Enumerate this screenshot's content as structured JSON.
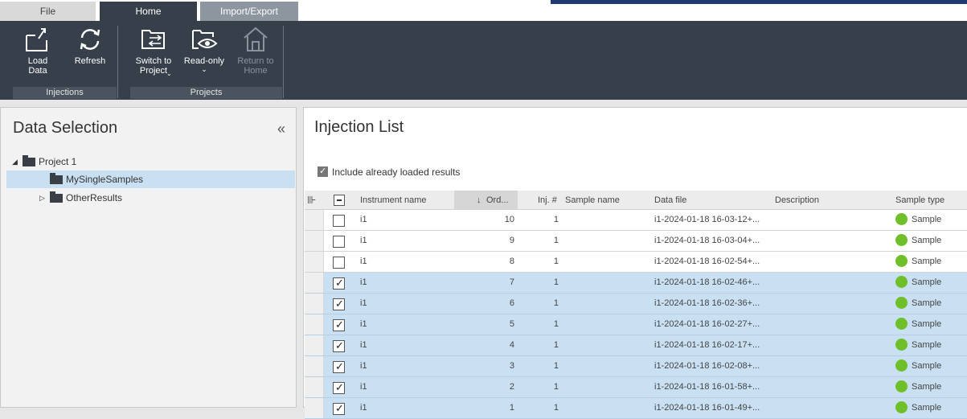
{
  "tabs": {
    "file": "File",
    "home": "Home",
    "import_export": "Import/Export"
  },
  "ribbon": {
    "load_data": "Load\nData",
    "refresh": "Refresh",
    "switch_to_project": "Switch to\nProject",
    "read_only": "Read-only",
    "return_to_home": "Return to\nHome",
    "group_injections": "Injections",
    "group_projects": "Projects"
  },
  "data_selection": {
    "title": "Data Selection",
    "tree": [
      {
        "label": "Project 1",
        "level": 0,
        "expanded": true,
        "selected": false
      },
      {
        "label": "MySingleSamples",
        "level": 1,
        "expanded": null,
        "selected": true
      },
      {
        "label": "OtherResults",
        "level": 1,
        "expanded": false,
        "selected": false
      }
    ]
  },
  "injection_list": {
    "title": "Injection List",
    "include_loaded_label": "Include already loaded results",
    "include_loaded_checked": true,
    "columns": {
      "instrument": "Instrument name",
      "order": "Ord...",
      "inj": "Inj. #",
      "sample_name": "Sample name",
      "data_file": "Data file",
      "description": "Description",
      "sample_type": "Sample type"
    },
    "rows": [
      {
        "checked": false,
        "instrument": "i1",
        "order": "10",
        "inj": "1",
        "sample_name": "",
        "data_file": "i1-2024-01-18 16-03-12+...",
        "description": "",
        "sample_type": "Sample"
      },
      {
        "checked": false,
        "instrument": "i1",
        "order": "9",
        "inj": "1",
        "sample_name": "",
        "data_file": "i1-2024-01-18 16-03-04+...",
        "description": "",
        "sample_type": "Sample"
      },
      {
        "checked": false,
        "instrument": "i1",
        "order": "8",
        "inj": "1",
        "sample_name": "",
        "data_file": "i1-2024-01-18 16-02-54+...",
        "description": "",
        "sample_type": "Sample"
      },
      {
        "checked": true,
        "instrument": "i1",
        "order": "7",
        "inj": "1",
        "sample_name": "",
        "data_file": "i1-2024-01-18 16-02-46+...",
        "description": "",
        "sample_type": "Sample"
      },
      {
        "checked": true,
        "instrument": "i1",
        "order": "6",
        "inj": "1",
        "sample_name": "",
        "data_file": "i1-2024-01-18 16-02-36+...",
        "description": "",
        "sample_type": "Sample"
      },
      {
        "checked": true,
        "instrument": "i1",
        "order": "5",
        "inj": "1",
        "sample_name": "",
        "data_file": "i1-2024-01-18 16-02-27+...",
        "description": "",
        "sample_type": "Sample"
      },
      {
        "checked": true,
        "instrument": "i1",
        "order": "4",
        "inj": "1",
        "sample_name": "",
        "data_file": "i1-2024-01-18 16-02-17+...",
        "description": "",
        "sample_type": "Sample"
      },
      {
        "checked": true,
        "instrument": "i1",
        "order": "3",
        "inj": "1",
        "sample_name": "",
        "data_file": "i1-2024-01-18 16-02-08+...",
        "description": "",
        "sample_type": "Sample"
      },
      {
        "checked": true,
        "instrument": "i1",
        "order": "2",
        "inj": "1",
        "sample_name": "",
        "data_file": "i1-2024-01-18 16-01-58+...",
        "description": "",
        "sample_type": "Sample"
      },
      {
        "checked": true,
        "instrument": "i1",
        "order": "1",
        "inj": "1",
        "sample_name": "",
        "data_file": "i1-2024-01-18 16-01-49+...",
        "description": "",
        "sample_type": "Sample"
      }
    ]
  },
  "colors": {
    "ribbon_bg": "#363f4a",
    "selection": "#c9e0f3",
    "sample_type_dot": "#6fbf2a"
  }
}
